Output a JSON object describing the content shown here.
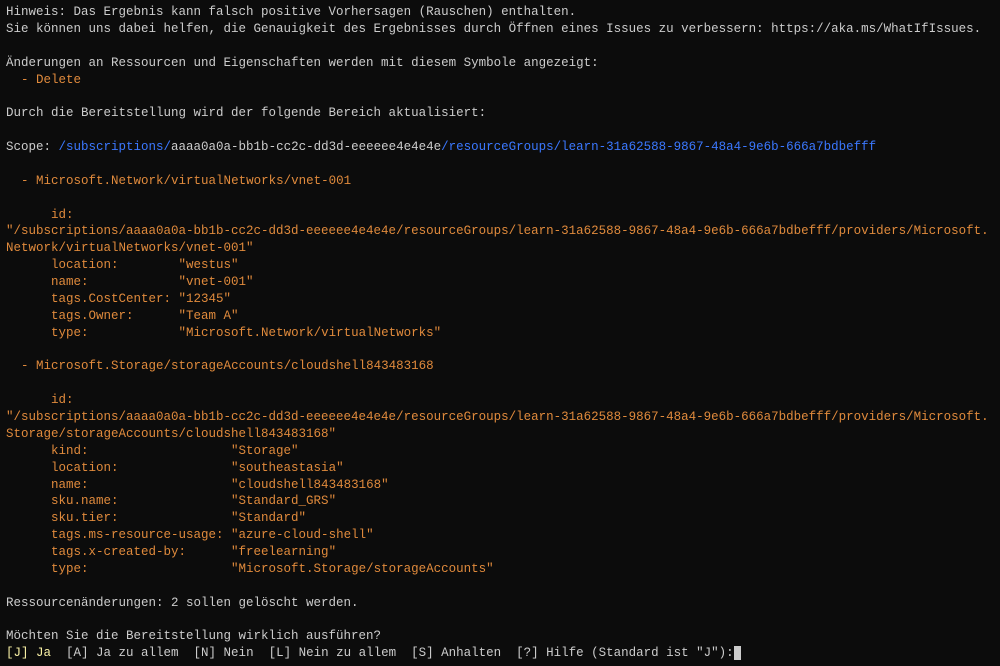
{
  "hint1": "Hinweis: Das Ergebnis kann falsch positive Vorhersagen (Rauschen) enthalten.",
  "hint2": "Sie können uns dabei helfen, die Genauigkeit des Ergebnisses durch Öffnen eines Issues zu verbessern: https://aka.ms/WhatIfIssues.",
  "changesHeader": "Änderungen an Ressourcen und Eigenschaften werden mit diesem Symbole angezeigt:",
  "deleteDash": "  - ",
  "deleteLabel": "Delete",
  "scopeIntro": "Durch die Bereitstellung wird der folgende Bereich aktualisiert:",
  "scopeLabel": "Scope: ",
  "scopePath1": "/subscriptions/",
  "scopeSubId": "aaaa0a0a-bb1b-cc2c-dd3d-eeeeee4e4e4e",
  "scopePath2": "/resourceGroups/",
  "scopeRg": "learn-31a62588-9867-48a4-9e6b-666a7bdbefff",
  "res1Dash": "  - ",
  "res1Title": "Microsoft.Network/virtualNetworks/vnet-001",
  "res1": {
    "idLabel": "      id:",
    "idValue": "\"/subscriptions/aaaa0a0a-bb1b-cc2c-dd3d-eeeeee4e4e4e/resourceGroups/learn-31a62588-9867-48a4-9e6b-666a7bdbefff/providers/Microsoft.Network/virtualNetworks/vnet-001\"",
    "locationLabel": "      location:        ",
    "locationValue": "\"westus\"",
    "nameLabel": "      name:            ",
    "nameValue": "\"vnet-001\"",
    "ccLabel": "      tags.CostCenter: ",
    "ccValue": "\"12345\"",
    "ownerLabel": "      tags.Owner:      ",
    "ownerValue": "\"Team A\"",
    "typeLabel": "      type:            ",
    "typeValue": "\"Microsoft.Network/virtualNetworks\""
  },
  "res2Dash": "  - ",
  "res2Title": "Microsoft.Storage/storageAccounts/cloudshell843483168",
  "res2": {
    "idLabel": "      id:",
    "idValue": "\"/subscriptions/aaaa0a0a-bb1b-cc2c-dd3d-eeeeee4e4e4e/resourceGroups/learn-31a62588-9867-48a4-9e6b-666a7bdbefff/providers/Microsoft.Storage/storageAccounts/cloudshell843483168\"",
    "kindLabel": "      kind:                   ",
    "kindValue": "\"Storage\"",
    "locationLabel": "      location:               ",
    "locationValue": "\"southeastasia\"",
    "nameLabel": "      name:                   ",
    "nameValue": "\"cloudshell843483168\"",
    "skuNameLabel": "      sku.name:               ",
    "skuNameValue": "\"Standard_GRS\"",
    "skuTierLabel": "      sku.tier:               ",
    "skuTierValue": "\"Standard\"",
    "usageLabel": "      tags.ms-resource-usage: ",
    "usageValue": "\"azure-cloud-shell\"",
    "createdByLabel": "      tags.x-created-by:      ",
    "createdByValue": "\"freelearning\"",
    "typeLabel": "      type:                   ",
    "typeValue": "\"Microsoft.Storage/storageAccounts\""
  },
  "summary": "Ressourcenänderungen: 2 sollen gelöscht werden.",
  "confirmQuestion": "Möchten Sie die Bereitstellung wirklich ausführen?",
  "promptYesKey": "[J] ",
  "promptYesLabel": "Ja",
  "promptRest": "  [A] Ja zu allem  [N] Nein  [L] Nein zu allem  [S] Anhalten  [?] Hilfe (Standard ist \"J\"):"
}
